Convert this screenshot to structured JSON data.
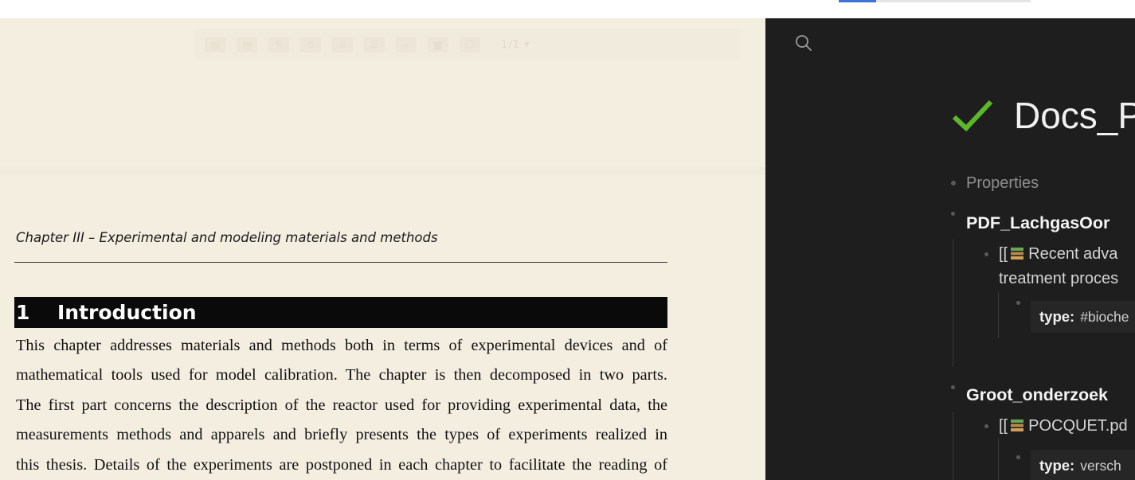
{
  "pdf_viewer": {
    "toolbar": {
      "page_indicator": "1/1 ▾"
    },
    "page": {
      "running_header": "Chapter III – Experimental and modeling materials and methods",
      "section_number": "1",
      "section_title": "Introduction",
      "body_lines": [
        "This chapter addresses materials and methods both in terms of experimental devices and of",
        "mathematical tools used for model calibration. The chapter is then decomposed in two parts.",
        "The first part concerns the description of the reactor used for providing experimental data, the",
        "measurements methods and apparels and briefly presents the types of experiments realized in",
        "this thesis. Details of the experiments are postponed in each chapter to facilitate the reading of"
      ]
    }
  },
  "notes": {
    "title": "Docs_P",
    "title_icon": "check-icon",
    "properties_label": "Properties",
    "sections": [
      {
        "heading": "PDF_LachgasOor",
        "link_prefix": "[[",
        "link_text_line1": "Recent adva",
        "link_text_line2": "treatment proces",
        "prop_key": "type:",
        "prop_value": "#bioche"
      },
      {
        "heading": "Groot_onderzoek",
        "link_prefix": "[[",
        "link_text_line1": "POCQUET.pd",
        "prop_key": "type:",
        "prop_value": "versch"
      }
    ],
    "colors": {
      "pane_background": "#1e1e1e",
      "check": "#5cb82a",
      "pdf_background": "#f4eee1"
    }
  }
}
